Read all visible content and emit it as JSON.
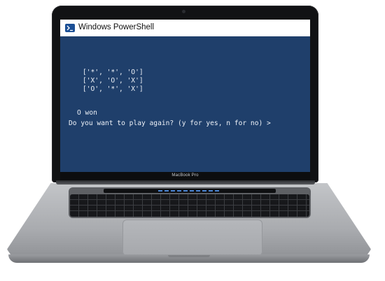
{
  "window": {
    "title": "Windows PowerShell",
    "icon": "powershell-icon"
  },
  "console": {
    "lines": [
      "['*', '*', 'O']",
      "['X', 'O', 'X']",
      "['O', '*', 'X']",
      "",
      "O won",
      "Do you want to play again? (y for yes, n for no) >"
    ]
  },
  "device": {
    "model_label": "MacBook Pro"
  },
  "colors": {
    "console_background": "#1f3f6b",
    "console_text": "#eef2f8",
    "titlebar_background": "#ffffff"
  }
}
